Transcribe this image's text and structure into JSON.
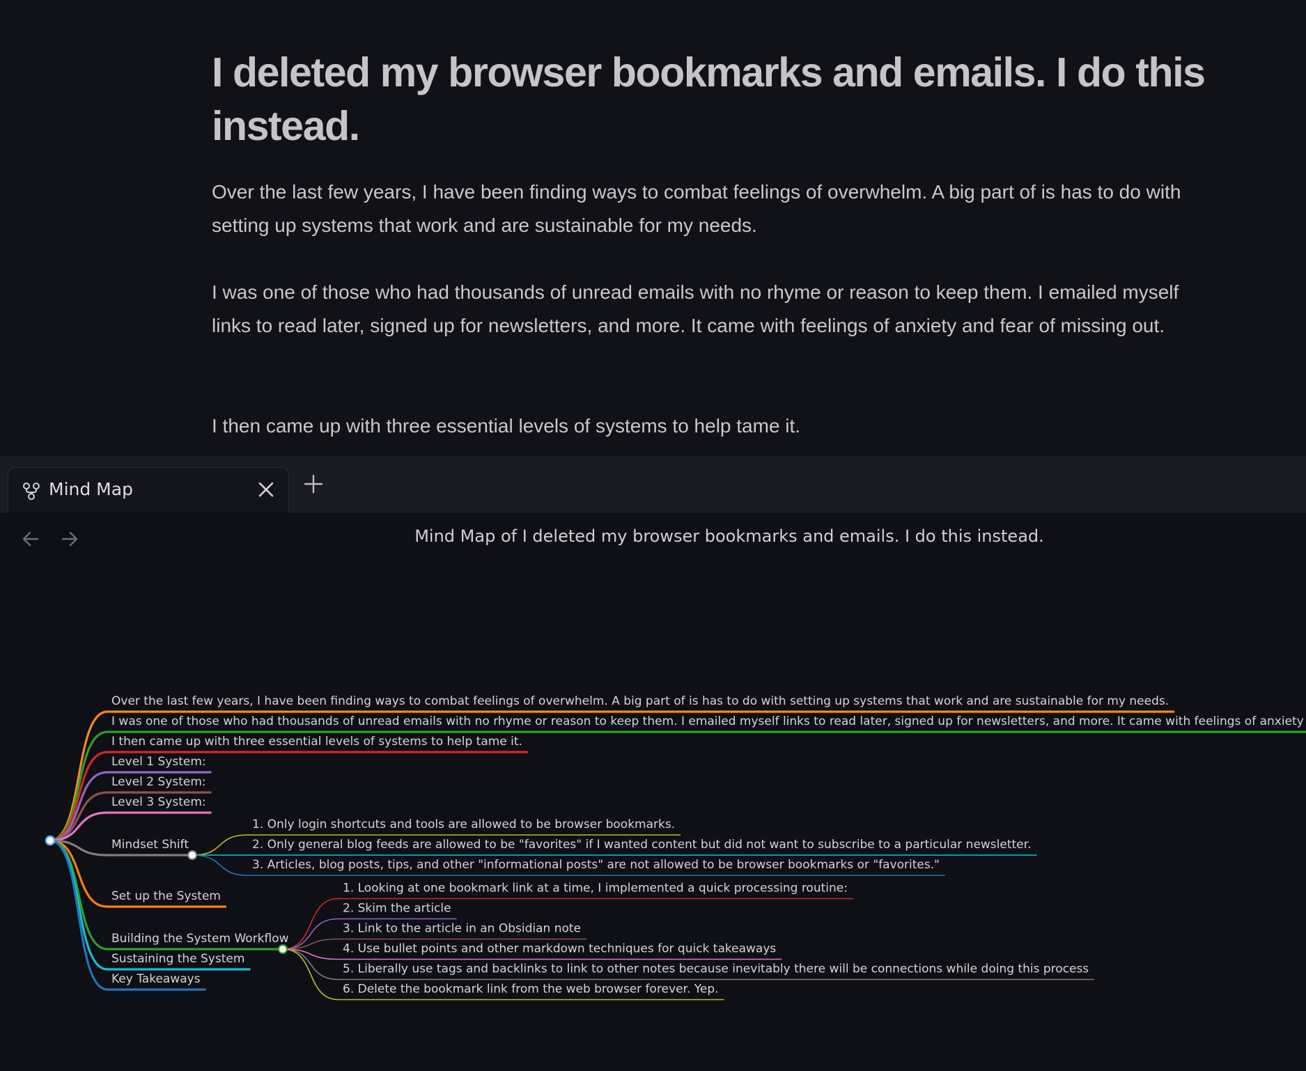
{
  "document": {
    "title": "I deleted my browser bookmarks and emails. I do this instead.",
    "paragraphs": [
      "Over the last few years, I have been finding ways to combat feelings of overwhelm. A big part of is has to do with setting up systems that work and are sustainable for my needs.",
      "I was one of those who had thousands of unread emails with no rhyme or reason to keep them. I emailed myself links to read later, signed up for newsletters, and more. It came with feelings of anxiety and fear of missing out.",
      "I then came up with three essential levels of systems to help tame it."
    ]
  },
  "tabs": {
    "active": {
      "label": "Mind Map",
      "icon": "mind-map-icon"
    },
    "close_icon": "close-icon",
    "add_icon": "plus-icon"
  },
  "view": {
    "title": "Mind Map of I deleted my browser bookmarks and emails. I do this instead.",
    "back_icon": "arrow-left-icon",
    "forward_icon": "arrow-right-icon"
  },
  "mindmap": {
    "root_color": "#5ab4e8",
    "branches": [
      {
        "label": "Over the last few years, I have been finding ways to combat feelings of overwhelm. A big part of is has to do with setting up systems that work and are sustainable for my needs.",
        "color": "#f58a1f"
      },
      {
        "label": "I was one of those who had thousands of unread emails with no rhyme or reason to keep them. I emailed myself links to read later, signed up for newsletters, and more. It came with feelings of anxiety and fear of missing out.",
        "color": "#2ca02c"
      },
      {
        "label": "I then came up with three essential levels of systems to help tame it.",
        "color": "#d62728"
      },
      {
        "label": "Level 1 System:",
        "color": "#9467bd"
      },
      {
        "label": "Level 2 System:",
        "color": "#8c564b"
      },
      {
        "label": "Level 3 System:",
        "color": "#e377c2"
      },
      {
        "label": "Mindset Shift",
        "color": "#7f7f7f",
        "children": [
          {
            "label": "1. Only login shortcuts and tools are allowed to be browser bookmarks.",
            "color": "#bcbd22"
          },
          {
            "label": "2. Only general blog feeds are allowed to be \"favorites\" if I wanted content but did not want to subscribe to a particular newsletter.",
            "color": "#17becf"
          },
          {
            "label": "3. Articles, blog posts, tips, and other \"informational posts\" are not allowed to be browser bookmarks or \"favorites.\"",
            "color": "#1f77b4"
          }
        ]
      },
      {
        "label": "Set up the System",
        "color": "#ff7f0e"
      },
      {
        "label": "Building the System Workflow",
        "color": "#2ca02c",
        "children": [
          {
            "label": "1. Looking at one bookmark link at a time, I implemented a quick processing routine:",
            "color": "#d62728"
          },
          {
            "label": "2. Skim the article",
            "color": "#9467bd"
          },
          {
            "label": "3. Link to the article in an Obsidian note",
            "color": "#8c564b"
          },
          {
            "label": "4. Use bullet points and other markdown techniques for quick takeaways",
            "color": "#e377c2"
          },
          {
            "label": "5. Liberally use tags and backlinks to link to other notes because inevitably there will be connections while doing this process",
            "color": "#7f7f7f"
          },
          {
            "label": "6. Delete the bookmark link from the web browser forever. Yep.",
            "color": "#bcbd22"
          }
        ]
      },
      {
        "label": "Sustaining the System",
        "color": "#17becf"
      },
      {
        "label": "Key Takeaways",
        "color": "#1f77b4"
      }
    ]
  }
}
